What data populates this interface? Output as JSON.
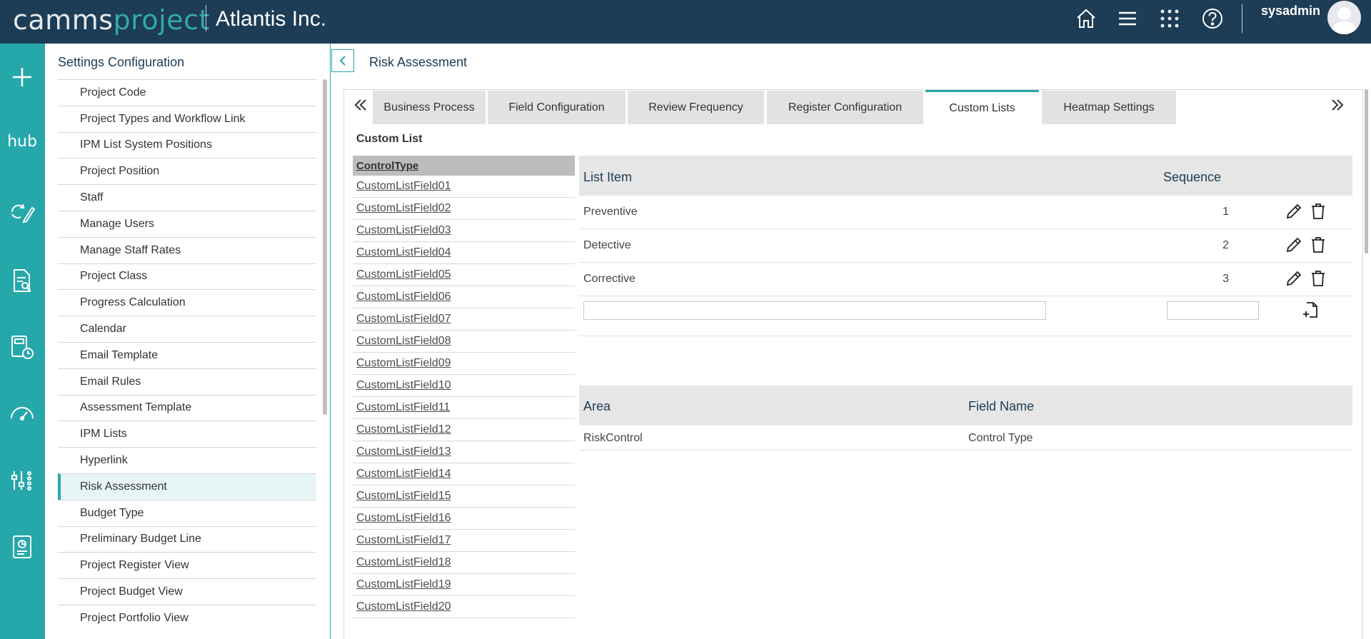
{
  "header": {
    "logo_part1": "camms",
    "logo_part2": "project",
    "company": "Atlantis Inc.",
    "username": "sysadmin",
    "icons": [
      "home-icon",
      "menu-icon",
      "apps-grid-icon",
      "help-icon"
    ]
  },
  "rail": {
    "hub_label": "hub",
    "icons": [
      "plus-icon",
      "hub-icon",
      "refresh-edit-icon",
      "document-search-icon",
      "calculator-clock-icon",
      "gauge-icon",
      "sliders-icon",
      "report-icon"
    ]
  },
  "settings": {
    "title": "Settings Configuration",
    "active_item": "Risk Assessment",
    "items": [
      "Project Code",
      "Project Types and Workflow Link",
      "IPM List System Positions",
      "Project Position",
      "Staff",
      "Manage Users",
      "Manage Staff Rates",
      "Project Class",
      "Progress Calculation",
      "Calendar",
      "Email Template",
      "Email Rules",
      "Assessment Template",
      "IPM Lists",
      "Hyperlink",
      "Risk Assessment",
      "Budget Type",
      "Preliminary Budget Line",
      "Project Register View",
      "Project Budget View",
      "Project Portfolio View"
    ]
  },
  "main": {
    "title": "Risk Assessment",
    "tabs": [
      {
        "label": "Business Process",
        "active": false
      },
      {
        "label": "Field Configuration",
        "active": false
      },
      {
        "label": "Review Frequency",
        "active": false
      },
      {
        "label": "Register Configuration",
        "active": false
      },
      {
        "label": "Custom Lists",
        "active": true
      },
      {
        "label": "Heatmap Settings",
        "active": false
      }
    ],
    "section_title": "Custom List",
    "control_list": {
      "header": "ControlType",
      "items": [
        "CustomListField01",
        "CustomListField02",
        "CustomListField03",
        "CustomListField04",
        "CustomListField05",
        "CustomListField06",
        "CustomListField07",
        "CustomListField08",
        "CustomListField09",
        "CustomListField10",
        "CustomListField11",
        "CustomListField12",
        "CustomListField13",
        "CustomListField14",
        "CustomListField15",
        "CustomListField16",
        "CustomListField17",
        "CustomListField18",
        "CustomListField19",
        "CustomListField20"
      ]
    },
    "list_grid": {
      "col_item": "List Item",
      "col_sequence": "Sequence",
      "rows": [
        {
          "item": "Preventive",
          "sequence": "1"
        },
        {
          "item": "Detective",
          "sequence": "2"
        },
        {
          "item": "Corrective",
          "sequence": "3"
        }
      ],
      "new_item_value": "",
      "new_sequence_value": ""
    },
    "area_grid": {
      "col_area": "Area",
      "col_field": "Field Name",
      "rows": [
        {
          "area": "RiskControl",
          "field": "Control Type"
        }
      ]
    }
  },
  "colors": {
    "header_bg": "#1d3c55",
    "rail_bg": "#26a8ab",
    "accent": "#2aa7a8",
    "logo_accent": "#33a9a9"
  }
}
